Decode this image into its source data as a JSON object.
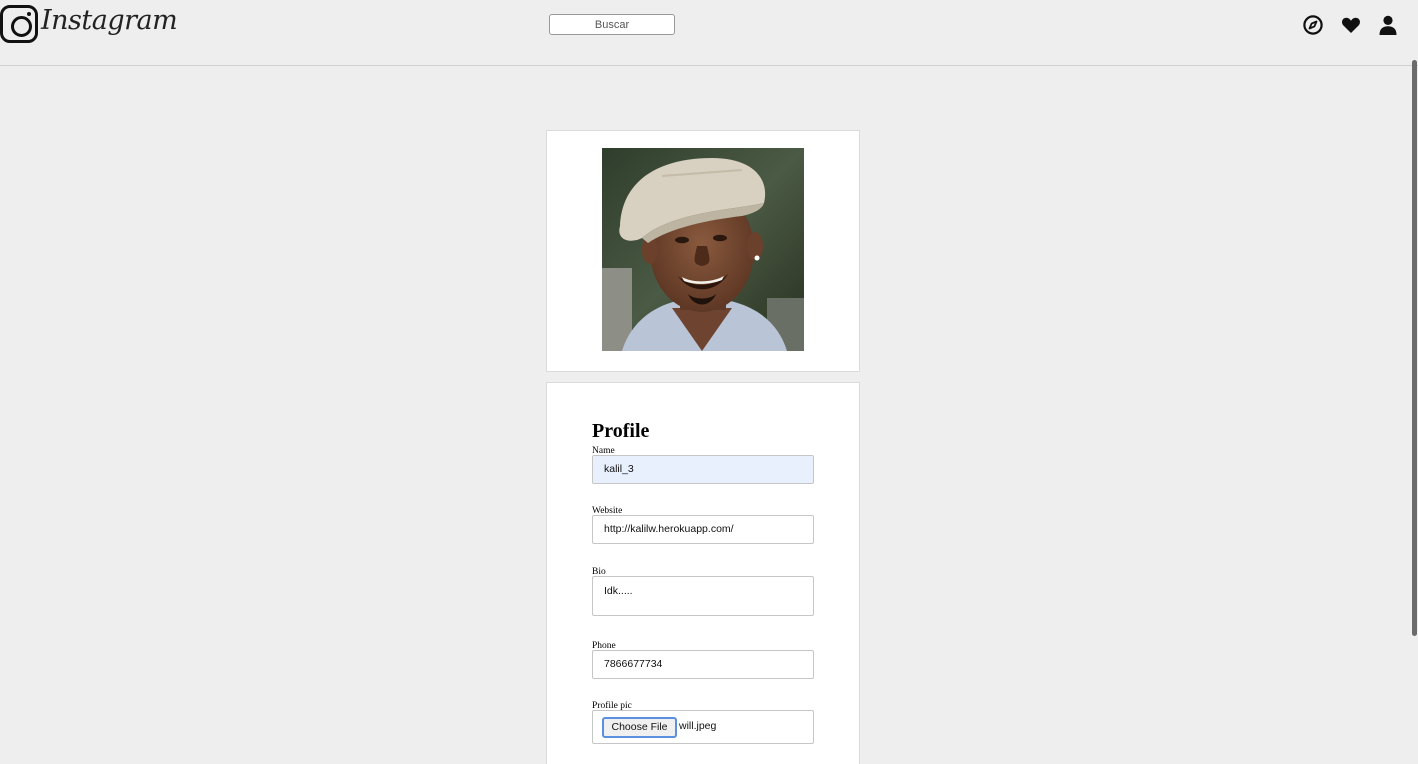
{
  "header": {
    "brand": "Instagram",
    "search_placeholder": "Buscar",
    "icons": [
      "compass-icon",
      "heart-icon",
      "user-icon"
    ]
  },
  "profile_photo": {
    "subject": "profile-photo"
  },
  "form": {
    "title": "Profile",
    "name_label": "Name",
    "name_value": "kalil_3",
    "website_label": "Website",
    "website_value": "http://kalilw.herokuapp.com/",
    "bio_label": "Bio",
    "bio_value": "Idk.....",
    "phone_label": "Phone",
    "phone_value": "7866677734",
    "pic_label": "Profile pic",
    "file_button": "Choose File",
    "file_name": "will.jpeg"
  },
  "colors": {
    "background": "#eeeeee",
    "autofill": "#e8f0fe",
    "focus": "#5b8fe0"
  }
}
